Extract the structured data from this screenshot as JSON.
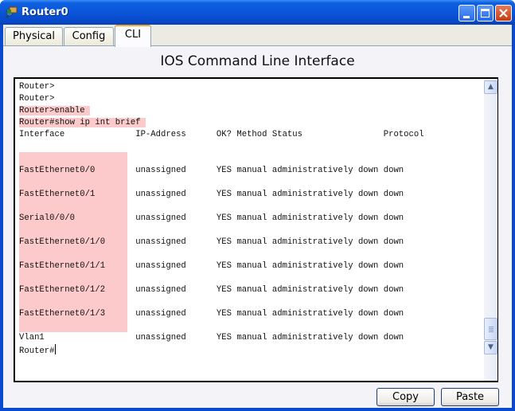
{
  "window": {
    "title": "Router0",
    "icon": "router-icon",
    "controls": [
      "minimize",
      "maximize",
      "close"
    ]
  },
  "tabs": [
    {
      "label": "Physical",
      "active": false
    },
    {
      "label": "Config",
      "active": false
    },
    {
      "label": "CLI",
      "active": true
    }
  ],
  "cli": {
    "heading": "IOS Command Line Interface",
    "lines": [
      "Router>",
      "Router>",
      "Router>enable ",
      "Router#show ip int brief ",
      "Interface              IP-Address      OK? Method Status                Protocol",
      "",
      "",
      "FastEthernet0/0        unassigned      YES manual administratively down down",
      "",
      "FastEthernet0/1        unassigned      YES manual administratively down down",
      "",
      "Serial0/0/0            unassigned      YES manual administratively down down",
      "",
      "FastEthernet0/1/0      unassigned      YES manual administratively down down",
      "",
      "FastEthernet0/1/1      unassigned      YES manual administratively down down",
      "",
      "FastEthernet0/1/2      unassigned      YES manual administratively down down",
      "",
      "FastEthernet0/1/3      unassigned      YES manual administratively down down",
      "",
      "Vlan1                  unassigned      YES manual administratively down down",
      "Router#"
    ],
    "highlight_color": "#fccaca"
  },
  "buttons": {
    "copy": "Copy",
    "paste": "Paste"
  }
}
